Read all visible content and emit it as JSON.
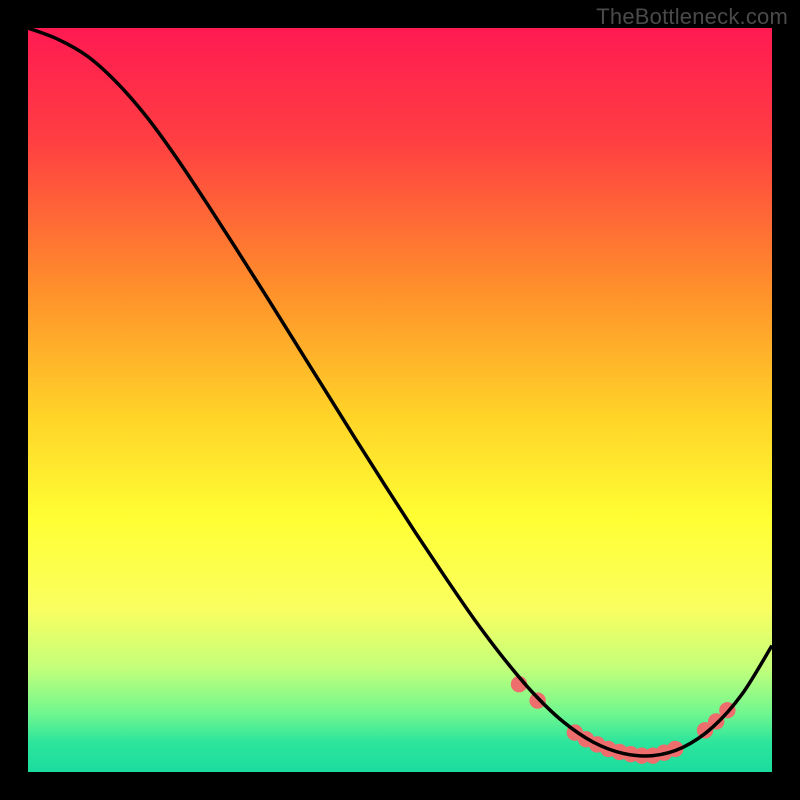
{
  "watermark": "TheBottleneck.com",
  "chart_data": {
    "type": "line",
    "title": "",
    "xlabel": "",
    "ylabel": "",
    "xlim": [
      0,
      100
    ],
    "ylim": [
      0,
      100
    ],
    "grid": false,
    "legend": false,
    "gradient_stops": [
      {
        "offset": 0,
        "color": "#ff1a52"
      },
      {
        "offset": 15,
        "color": "#ff3e42"
      },
      {
        "offset": 35,
        "color": "#ff8f2b"
      },
      {
        "offset": 52,
        "color": "#ffd328"
      },
      {
        "offset": 66,
        "color": "#ffff33"
      },
      {
        "offset": 78,
        "color": "#faff60"
      },
      {
        "offset": 86,
        "color": "#c3ff7a"
      },
      {
        "offset": 92,
        "color": "#72f78e"
      },
      {
        "offset": 96,
        "color": "#2de59c"
      },
      {
        "offset": 100,
        "color": "#1bdc9e"
      }
    ],
    "series": [
      {
        "name": "bottleneck-curve",
        "color": "#000000",
        "x": [
          0,
          4,
          8,
          12,
          16,
          20,
          24,
          28,
          32,
          36,
          40,
          44,
          48,
          52,
          56,
          60,
          64,
          68,
          72,
          76,
          80,
          84,
          88,
          92,
          96,
          100
        ],
        "y": [
          100,
          98.5,
          96.2,
          92.6,
          88,
          82.5,
          76.5,
          70.3,
          64,
          57.6,
          51.2,
          44.8,
          38.5,
          32.3,
          26.3,
          20.5,
          15.2,
          10.5,
          6.7,
          4,
          2.5,
          2.2,
          3.3,
          6,
          10.5,
          17
        ]
      }
    ],
    "markers": {
      "name": "highlight-dots",
      "color": "#ee6d6d",
      "radius_pct": 1.1,
      "points": [
        {
          "x": 66,
          "y": 11.8
        },
        {
          "x": 68.5,
          "y": 9.6
        },
        {
          "x": 73.5,
          "y": 5.3
        },
        {
          "x": 75,
          "y": 4.4
        },
        {
          "x": 76.5,
          "y": 3.7
        },
        {
          "x": 78,
          "y": 3.1
        },
        {
          "x": 79.5,
          "y": 2.7
        },
        {
          "x": 81,
          "y": 2.4
        },
        {
          "x": 82.5,
          "y": 2.2
        },
        {
          "x": 84,
          "y": 2.2
        },
        {
          "x": 85.5,
          "y": 2.6
        },
        {
          "x": 87,
          "y": 3.1
        },
        {
          "x": 91,
          "y": 5.6
        },
        {
          "x": 92.5,
          "y": 6.8
        },
        {
          "x": 94,
          "y": 8.3
        }
      ]
    }
  }
}
